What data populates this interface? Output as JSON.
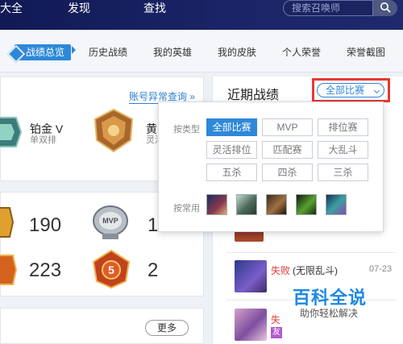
{
  "top_nav": {
    "items": [
      "大全",
      "发现",
      "查找"
    ],
    "search_placeholder": "搜索召唤师"
  },
  "sub_tabs": {
    "items": [
      "战绩总览",
      "历史战绩",
      "我的英雄",
      "我的皮肤",
      "个人荣誉",
      "荣誉截图"
    ],
    "active_index": 0
  },
  "rank_panel": {
    "tier1_name": "铂金 V",
    "tier1_queue": "单双排",
    "tier2_name": "黄",
    "tier2_queue": "灵活",
    "abnormal_link": "账号异常查询"
  },
  "stats_panel": {
    "mvp_badge": "MVP",
    "pentakill_badge": "5",
    "values": [
      "190",
      "1",
      "223",
      "2"
    ]
  },
  "more_button": "更多",
  "recent": {
    "title": "近期战绩",
    "filter_label": "全部比赛"
  },
  "filter_dropdown": {
    "type_label": "按类型",
    "type_options": [
      "全部比赛",
      "MVP",
      "排位赛",
      "灵活排位",
      "匹配赛",
      "大乱斗",
      "五杀",
      "四杀",
      "三杀"
    ],
    "active_option": 0,
    "common_label": "按常用"
  },
  "matches": [
    {
      "result": "失败",
      "mode": "(无限乱斗)",
      "date": "07-23"
    },
    {
      "result": "失",
      "mode": "",
      "date": ""
    }
  ],
  "watermark": {
    "title": "百科全说",
    "subtitle": "助你轻松解决"
  },
  "colors": {
    "accent": "#2e88d8",
    "nav_bg": "#1a2466",
    "highlight_box": "#e53935",
    "lose": "#e53935"
  }
}
